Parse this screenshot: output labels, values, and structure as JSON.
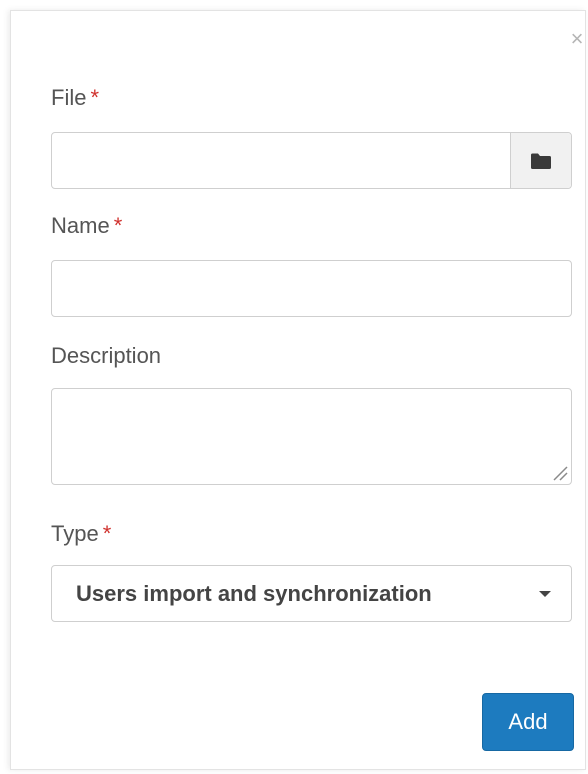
{
  "dialog": {
    "close_glyph": "×",
    "fields": {
      "file": {
        "label": "File",
        "required_mark": "*",
        "value": "",
        "button_icon": "folder-icon"
      },
      "name": {
        "label": "Name",
        "required_mark": "*",
        "value": ""
      },
      "description": {
        "label": "Description",
        "value": ""
      },
      "type": {
        "label": "Type",
        "required_mark": "*",
        "selected": "Users import and synchronization"
      }
    },
    "add_label": "Add"
  },
  "colors": {
    "primary": "#1d7bbf",
    "required": "#d0312d",
    "label": "#555555",
    "border": "#cfcfcf"
  }
}
